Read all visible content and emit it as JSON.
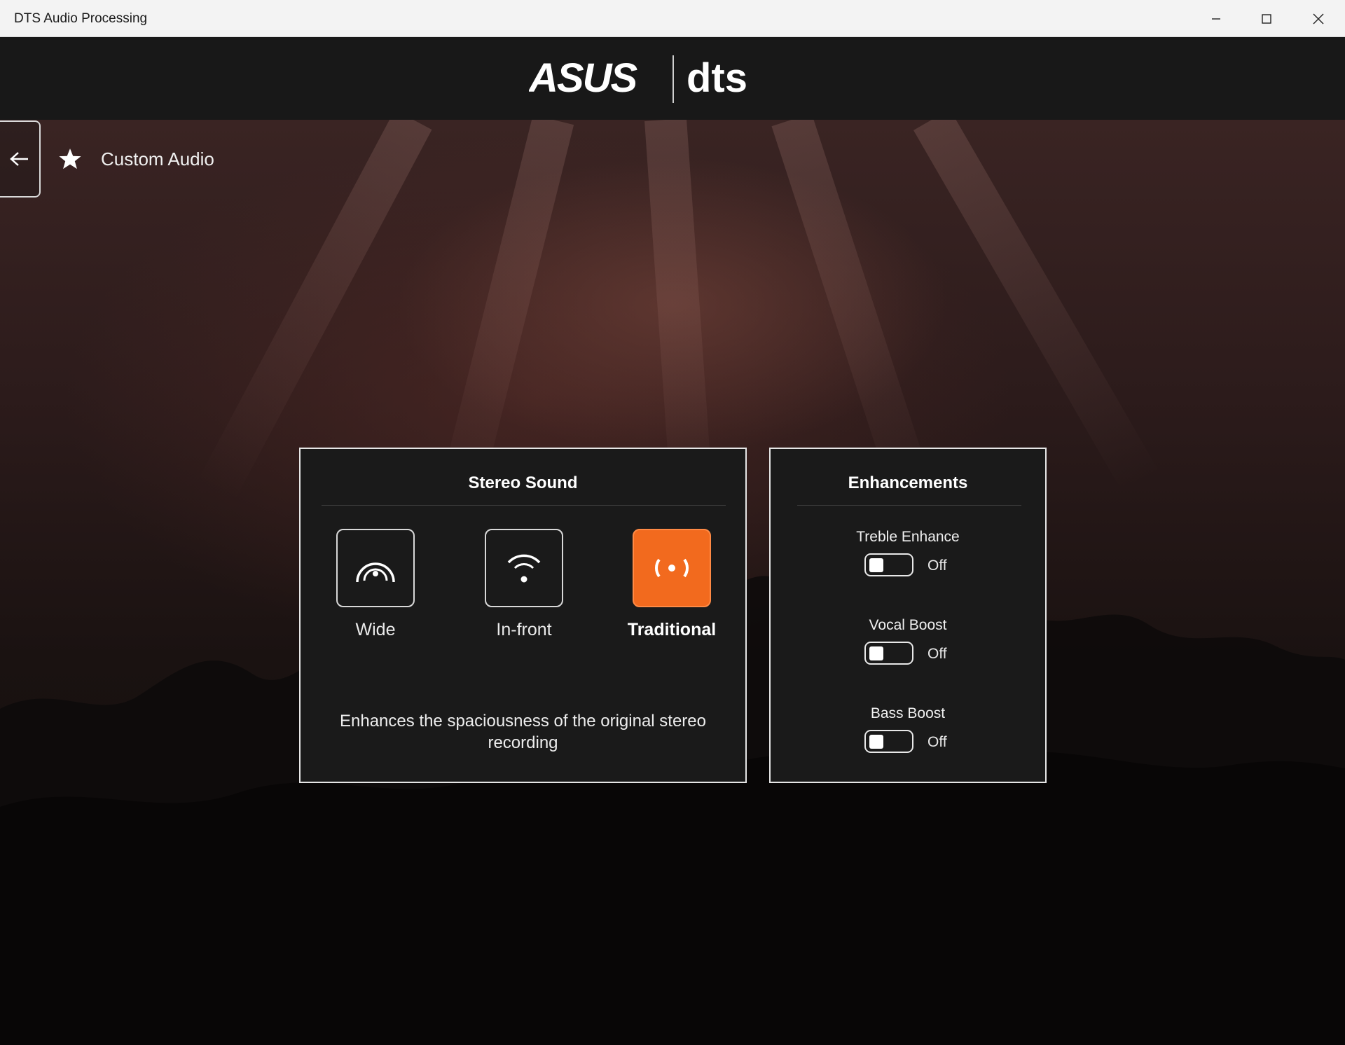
{
  "window": {
    "title": "DTS Audio Processing"
  },
  "brand": {
    "left_logo_text": "ASUS",
    "right_logo_text": "dts"
  },
  "nav": {
    "back_icon": "arrow-left-icon",
    "favorite_icon": "star-icon",
    "page_title": "Custom Audio"
  },
  "stereo_sound": {
    "title": "Stereo Sound",
    "modes": [
      {
        "label": "Wide",
        "icon": "wide-arc-icon",
        "selected": false
      },
      {
        "label": "In-front",
        "icon": "in-front-icon",
        "selected": false
      },
      {
        "label": "Traditional",
        "icon": "traditional-icon",
        "selected": true
      }
    ],
    "description": "Enhances the spaciousness of the original stereo recording"
  },
  "enhancements": {
    "title": "Enhancements",
    "items": [
      {
        "label": "Treble Enhance",
        "state": "Off"
      },
      {
        "label": "Vocal Boost",
        "state": "Off"
      },
      {
        "label": "Bass Boost",
        "state": "Off"
      }
    ]
  },
  "colors": {
    "accent": "#f26a1e",
    "panel_bg": "#1a1a1a",
    "titlebar_bg": "#f3f3f3"
  }
}
